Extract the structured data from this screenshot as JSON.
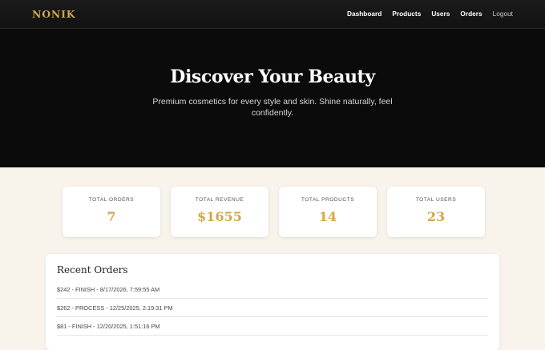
{
  "nav": {
    "brand": "NONIK",
    "links": [
      "Dashboard",
      "Products",
      "Users",
      "Orders",
      "Logout"
    ]
  },
  "hero": {
    "title": "Discover Your Beauty",
    "subtitle": "Premium cosmetics for every style and skin. Shine naturally, feel confidently."
  },
  "stats": [
    {
      "label": "TOTAL ORDERS",
      "value": "7"
    },
    {
      "label": "TOTAL REVENUE",
      "value": "$1655"
    },
    {
      "label": "TOTAL PRODUCTS",
      "value": "14"
    },
    {
      "label": "TOTAL USERS",
      "value": "23"
    }
  ],
  "recent_orders": {
    "title": "Recent Orders",
    "items": [
      "$242 - FINISH - 8/17/2026, 7:59:55 AM",
      "$262 - PROCESS - 12/25/2025, 2:19:31 PM",
      "$81 - FINISH - 12/20/2025, 1:51:16 PM"
    ]
  },
  "colors": {
    "accent_gold": "#cfa84a",
    "nav_bg": "#151515",
    "hero_bg": "#0b0b0b",
    "page_bg": "#f8f4ec"
  }
}
